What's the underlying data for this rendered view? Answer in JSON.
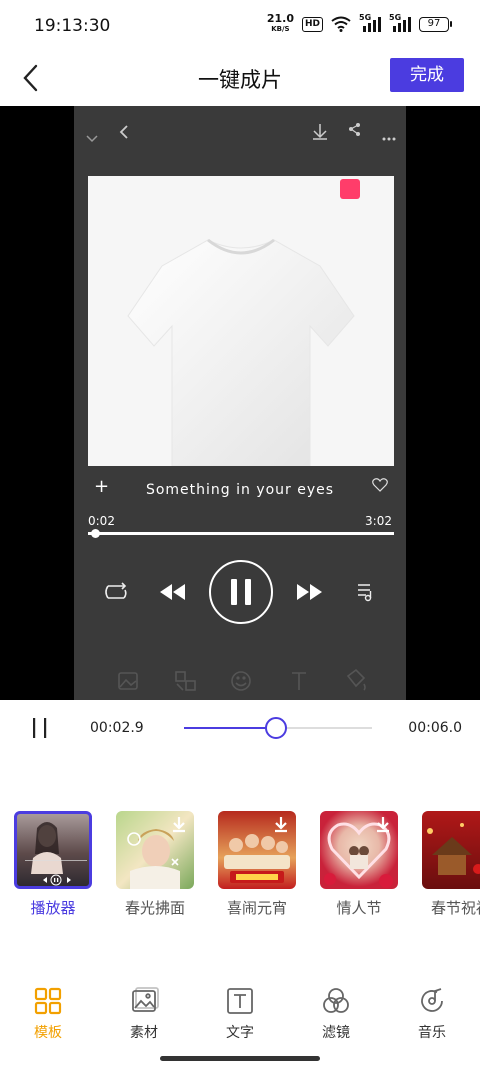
{
  "status": {
    "time": "19:13:30",
    "net_speed": "21.0",
    "net_unit": "KB/S",
    "hd": "HD",
    "sig1": "5G",
    "sig2": "5G",
    "battery": "97"
  },
  "header": {
    "title": "一键成片",
    "done_label": "完成"
  },
  "preview": {
    "song_title": "Something in your eyes",
    "elapsed": "0:02",
    "duration": "3:02",
    "song_progress": 0.011
  },
  "timeline": {
    "current": "00:02.9",
    "total": "00:06.0",
    "progress": 0.49
  },
  "templates": [
    {
      "label": "播放器",
      "selected": true
    },
    {
      "label": "春光拂面",
      "selected": false
    },
    {
      "label": "喜闹元宵",
      "selected": false
    },
    {
      "label": "情人节",
      "selected": false
    },
    {
      "label": "春节祝福",
      "selected": false
    }
  ],
  "tabs": [
    {
      "label": "模板",
      "icon": "grid-icon",
      "active": true
    },
    {
      "label": "素材",
      "icon": "image-icon",
      "active": false
    },
    {
      "label": "文字",
      "icon": "text-icon",
      "active": false
    },
    {
      "label": "滤镜",
      "icon": "filter-icon",
      "active": false
    },
    {
      "label": "音乐",
      "icon": "music-icon",
      "active": false
    }
  ],
  "colors": {
    "accent": "#4b3ce0",
    "tab_active": "#f2a000"
  }
}
